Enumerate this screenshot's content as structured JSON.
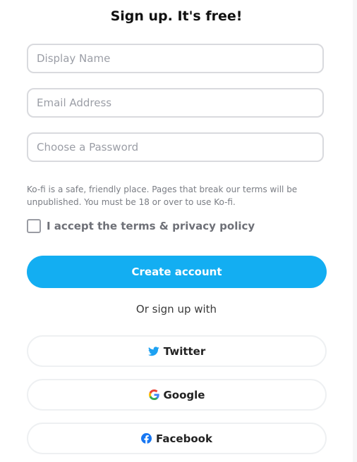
{
  "header": {
    "title": "Sign up. It's free!"
  },
  "form": {
    "display_name_placeholder": "Display Name",
    "email_placeholder": "Email Address",
    "password_placeholder": "Choose a Password",
    "notice": "Ko-fi is a safe, friendly place. Pages that break our terms will be unpublished. You must be 18 or over to use Ko-fi.",
    "terms_label": "I accept the terms & privacy policy",
    "create_label": "Create account"
  },
  "social": {
    "divider_text": "Or sign up with",
    "buttons": [
      {
        "label": "Twitter",
        "icon": "twitter-icon"
      },
      {
        "label": "Google",
        "icon": "google-icon"
      },
      {
        "label": "Facebook",
        "icon": "facebook-icon"
      }
    ]
  },
  "colors": {
    "accent": "#13aef2",
    "twitter": "#1da1f2",
    "facebook": "#1877f2"
  }
}
